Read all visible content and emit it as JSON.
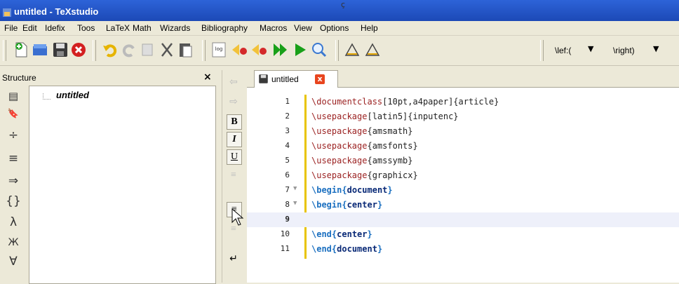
{
  "window": {
    "title": "untitled - TeXstudio",
    "top_marker": "ç"
  },
  "menu": [
    "File",
    "Edit",
    "Idefix",
    "Toos",
    "LaTeX",
    "Math",
    "Wizards",
    "Bibliography",
    "Macros",
    "View",
    "Options",
    "Help"
  ],
  "toolbar": {
    "combo1_label": "\\lef:(",
    "combo2_label": "\\right)",
    "log_label": "log"
  },
  "structure": {
    "title": "Structure",
    "close": "×",
    "tree_root": "untitled",
    "icons": [
      "▤",
      "🔖",
      "÷",
      "≡",
      "⇒",
      "{}",
      "λ",
      "Ж",
      "∀"
    ]
  },
  "format": {
    "bold": "B",
    "italic": "I",
    "underline": "U",
    "newline": "↵"
  },
  "tabs": [
    {
      "label": "untitled",
      "close": "x"
    }
  ],
  "editor": {
    "lines": [
      {
        "n": "1",
        "cmd": "\\documentclass",
        "rest": "[10pt,a4paper]{article}"
      },
      {
        "n": "2",
        "cmd": "\\usepackage",
        "rest": "[latin5]{inputenc}"
      },
      {
        "n": "3",
        "cmd": "\\usepackage",
        "rest": "{amsmath}"
      },
      {
        "n": "4",
        "cmd": "\\usepackage",
        "rest": "{amsfonts}"
      },
      {
        "n": "5",
        "cmd": "\\usepackage",
        "rest": "{amssymb}"
      },
      {
        "n": "6",
        "cmd": "\\usepackage",
        "rest": "{graphicx}"
      },
      {
        "n": "7",
        "env": "\\begin",
        "open": "{",
        "name": "document",
        "close": "}"
      },
      {
        "n": "8",
        "env": "\\begin",
        "open": "{",
        "name": "center",
        "close": "}"
      },
      {
        "n": "9"
      },
      {
        "n": "10",
        "env": "\\end",
        "open": "{",
        "name": "center",
        "close": "}"
      },
      {
        "n": "11",
        "env": "\\end",
        "open": "{",
        "name": "document",
        "close": "}"
      }
    ]
  },
  "colors": {
    "command": "#9a1f1f",
    "environment": "#1a6fc0",
    "envname": "#0a2a77",
    "fold": "#e8c400",
    "current_line": "#eef0fa",
    "titlebar": "#2d63d8"
  }
}
